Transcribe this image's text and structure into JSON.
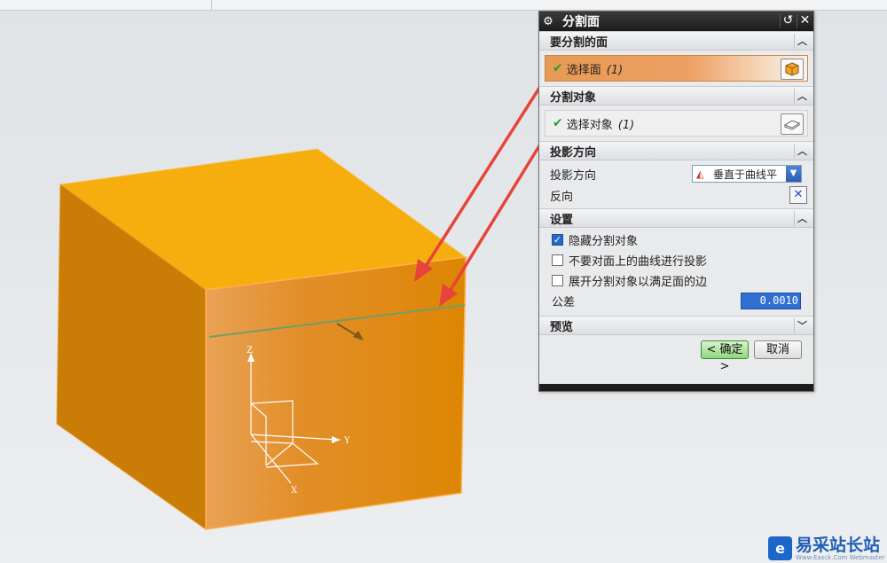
{
  "dialog": {
    "title": "分割面",
    "sections": {
      "face_to_split": {
        "header": "要分割的面",
        "select_label": "选择面",
        "select_count": "(1)"
      },
      "split_object": {
        "header": "分割对象",
        "select_label": "选择对象",
        "select_count": "(1)"
      },
      "projection": {
        "header": "投影方向",
        "direction_label": "投影方向",
        "direction_value": "垂直于曲线平",
        "reverse_label": "反向"
      },
      "settings": {
        "header": "设置",
        "hide_split_object": {
          "label": "隐藏分割对象",
          "checked": true
        },
        "no_project_on_face": {
          "label": "不要对面上的曲线进行投影",
          "checked": false
        },
        "expand_split_object": {
          "label": "展开分割对象以满足面的边",
          "checked": false
        },
        "tolerance_label": "公差",
        "tolerance_value": "0.0010"
      },
      "preview": {
        "header": "预览"
      }
    },
    "buttons": {
      "ok": "< 确定 >",
      "cancel": "取消"
    }
  },
  "viewport": {
    "axis_labels": {
      "z": "Z",
      "y": "Y",
      "x": "X"
    },
    "colors": {
      "top_face": "#f5ae0d",
      "front_face": "#dd8603",
      "side_face": "#c97c06",
      "split_line": "#6f9e6a",
      "arrows": "#e8433a"
    }
  },
  "watermark": {
    "name": "易采站长站",
    "url": "Www.Easck.Com Webmaster"
  }
}
